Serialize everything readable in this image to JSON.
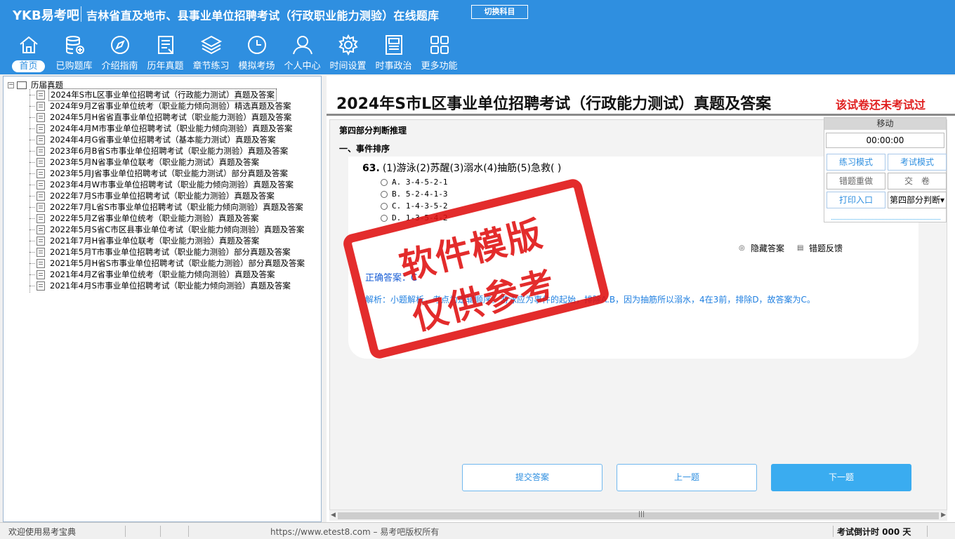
{
  "header": {
    "logo": "YKB易考吧",
    "title": "吉林省直及地市、县事业单位招聘考试（行政职业能力测验）在线题库",
    "switch_label": "切换科目"
  },
  "nav": [
    {
      "label": "首页",
      "icon": "home-icon"
    },
    {
      "label": "已购题库",
      "icon": "database-icon"
    },
    {
      "label": "介绍指南",
      "icon": "compass-icon"
    },
    {
      "label": "历年真题",
      "icon": "document-list-icon"
    },
    {
      "label": "章节练习",
      "icon": "layers-icon"
    },
    {
      "label": "模拟考场",
      "icon": "clock-icon"
    },
    {
      "label": "个人中心",
      "icon": "user-icon"
    },
    {
      "label": "时间设置",
      "icon": "gear-icon"
    },
    {
      "label": "时事政治",
      "icon": "news-icon"
    },
    {
      "label": "更多功能",
      "icon": "grid-icon"
    }
  ],
  "tree": {
    "root": "历届真题",
    "items": [
      "2024年S市L区事业单位招聘考试（行政能力测试）真题及答案",
      "2024年9月Z省事业单位统考（职业能力倾向测验）精选真题及答案",
      "2024年5月H省省直事业单位招聘考试（职业能力测验）真题及答案",
      "2024年4月M市事业单位招聘考试（职业能力倾向测验）真题及答案",
      "2024年4月G省事业单位招聘考试（基本能力测试）真题及答案",
      "2023年6月B省S市事业单位招聘考试（职业能力测验）真题及答案",
      "2023年5月N省事业单位联考（职业能力测试）真题及答案",
      "2023年5月J省事业单位招聘考试（职业能力测试）部分真题及答案",
      "2023年4月W市事业单位招聘考试（职业能力倾向测验）真题及答案",
      "2022年7月S市事业单位招聘考试（职业能力测验）真题及答案",
      "2022年7月L省S市事业单位招聘考试（职业能力倾向测验）真题及答案",
      "2022年5月Z省事业单位统考（职业能力测验）真题及答案",
      "2022年5月S省C市区县事业单位考试（职业能力倾向测验）真题及答案",
      "2021年7月H省事业单位联考（职业能力测验）真题及答案",
      "2021年5月T市事业单位招聘考试（职业能力测验）部分真题及答案",
      "2021年5月H省S市事业单位招聘考试（职业能力测验）部分真题及答案",
      "2021年4月Z省事业单位统考（职业能力倾向测验）真题及答案",
      "2021年4月S市事业单位招聘考试（职业能力倾向测验）真题及答案"
    ]
  },
  "paper": {
    "title": "2024年S市L区事业单位招聘考试（行政能力测试）真题及答案",
    "status": "该试卷还未考试过",
    "section": "第四部分判断推理",
    "subsection": "一、事件排序",
    "question": {
      "number": "63.",
      "stem": "(1)游泳(2)苏醒(3)溺水(4)抽筋(5)急救( )",
      "options": [
        "A. 3-4-5-2-1",
        "B. 5-2-4-1-3",
        "C. 1-4-3-5-2",
        "D. 1-3-5-4-2"
      ],
      "hide_answer": "隐藏答案",
      "report_error": "错题反馈",
      "answer": "正确答案：C",
      "analysis": "解析：小题解析，考点为逻辑顺序。游泳应为事件的起始，排除A.B，因为抽筋所以溺水，4在3前，排除D，故答案为C。"
    },
    "buttons": {
      "submit": "提交答案",
      "prev": "上一题",
      "next": "下一题"
    }
  },
  "panel": {
    "move": "移动",
    "timer": "00:00:00",
    "practice_mode": "练习模式",
    "exam_mode": "考试模式",
    "redo_wrong": "错题重做",
    "hand_in": "交　卷",
    "print": "打印入口",
    "section_select": "第四部分判断"
  },
  "watermark": {
    "line1": "软件模版",
    "line2": "仅供参考"
  },
  "status": {
    "welcome": "欢迎使用易考宝典",
    "url": "https://www.etest8.com – 易考吧版权所有",
    "countdown": "考试倒计时 000 天"
  },
  "colors": {
    "header": "#2f8fe0",
    "accent_red": "#e01010",
    "link_blue": "#1f7fe0"
  }
}
